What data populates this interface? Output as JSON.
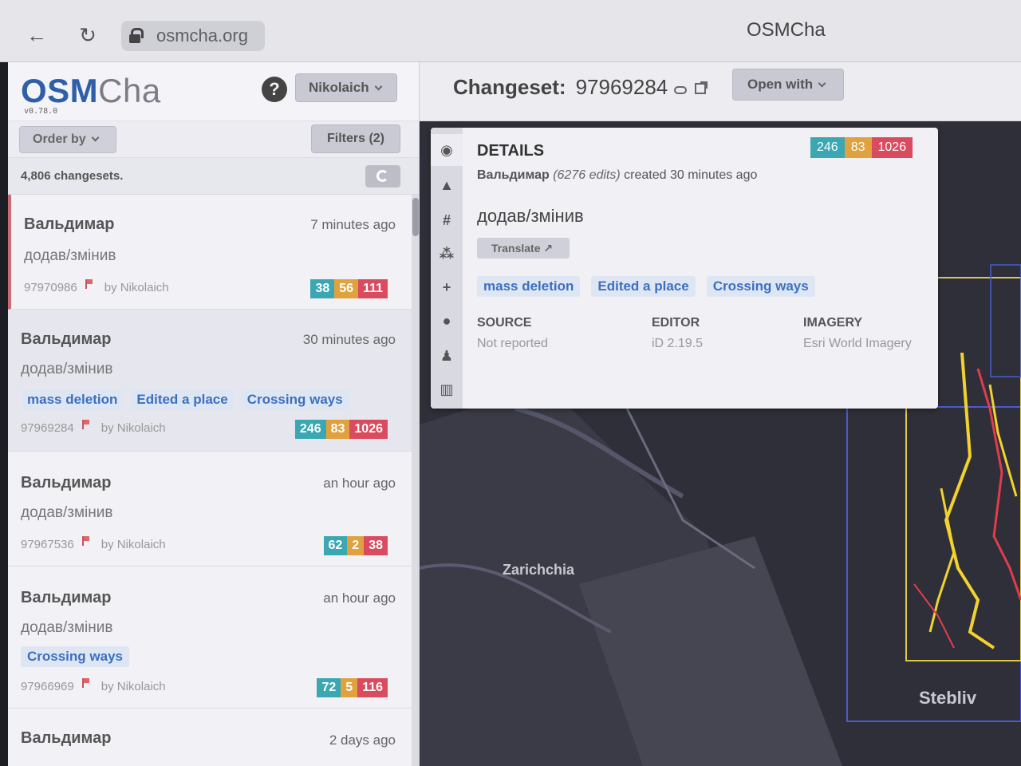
{
  "browser": {
    "url": "osmcha.org",
    "window_title": "OSMCha",
    "back_glyph": "←",
    "reload_glyph": "↻"
  },
  "sidebar": {
    "logo_osm": "OSM",
    "logo_cha": "Cha",
    "version": "v0.78.0",
    "help_glyph": "?",
    "user_menu": "Nikolaich",
    "order_by": "Order by",
    "filters": "Filters (2)",
    "count": "4,806 changesets."
  },
  "changesets": [
    {
      "user": "Вальдимар",
      "time": "7 minutes ago",
      "comment": "додав/змінив",
      "tags": [],
      "id": "97970986",
      "by": "by Nikolaich",
      "added": "38",
      "modified": "56",
      "deleted": "111"
    },
    {
      "user": "Вальдимар",
      "time": "30 minutes ago",
      "comment": "додав/змінив",
      "tags": [
        "mass deletion",
        "Edited a place",
        "Crossing ways"
      ],
      "id": "97969284",
      "by": "by Nikolaich",
      "added": "246",
      "modified": "83",
      "deleted": "1026"
    },
    {
      "user": "Вальдимар",
      "time": "an hour ago",
      "comment": "додав/змінив",
      "tags": [],
      "id": "97967536",
      "by": "by Nikolaich",
      "added": "62",
      "modified": "2",
      "deleted": "38"
    },
    {
      "user": "Вальдимар",
      "time": "an hour ago",
      "comment": "додав/змінив",
      "tags": [
        "Crossing ways"
      ],
      "id": "97966969",
      "by": "by Nikolaich",
      "added": "72",
      "modified": "5",
      "deleted": "116"
    },
    {
      "user": "Вальдимар",
      "time": "2 days ago",
      "comment": "",
      "tags": [],
      "id": "",
      "by": "",
      "added": "",
      "modified": "",
      "deleted": ""
    }
  ],
  "header": {
    "changeset_label": "Changeset:",
    "changeset_id": "97969284",
    "open_with": "Open with"
  },
  "details": {
    "title": "DETAILS",
    "user": "Вальдимар",
    "edits": "(6276 edits)",
    "created": "created 30 minutes ago",
    "comment": "додав/змінив",
    "translate": "Translate",
    "tags": [
      "mass deletion",
      "Edited a place",
      "Crossing ways"
    ],
    "added": "246",
    "modified": "83",
    "deleted": "1026",
    "source_label": "SOURCE",
    "source_value": "Not reported",
    "editor_label": "EDITOR",
    "editor_value": "iD 2.19.5",
    "imagery_label": "IMAGERY",
    "imagery_value": "Esri World Imagery",
    "rail": [
      "eye-icon",
      "warning-icon",
      "hash-icon",
      "tags-icon",
      "plus-icon",
      "comment-icon",
      "user-icon",
      "map-icon"
    ]
  },
  "map": {
    "labels": [
      "Zarichchia",
      "Stebliv"
    ]
  },
  "colors": {
    "added": "#3aa7b2",
    "modified": "#e0a23e",
    "deleted": "#d94b5e",
    "brand": "#2f5fa8",
    "tag_text": "#3b70c0"
  }
}
